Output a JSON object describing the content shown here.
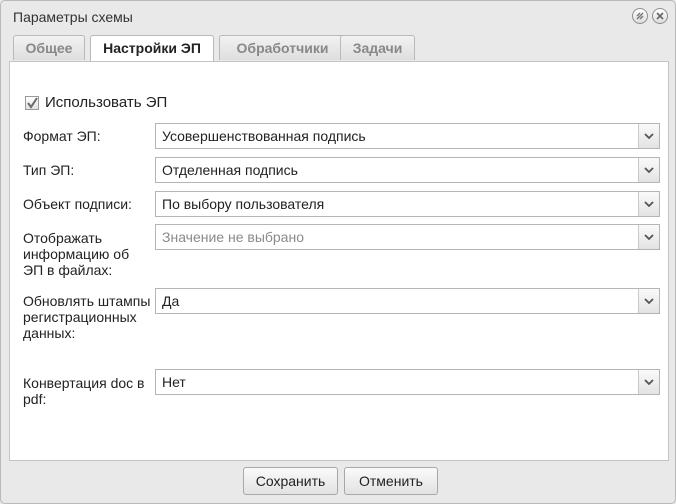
{
  "window": {
    "title": "Параметры схемы"
  },
  "tabs": [
    {
      "label": "Общее"
    },
    {
      "label": "Настройки ЭП"
    },
    {
      "label": "Обработчики"
    },
    {
      "label": "Задачи"
    }
  ],
  "form": {
    "use_ep": {
      "label": "Использовать ЭП",
      "checked": true
    },
    "format": {
      "label": "Формат ЭП:",
      "value": "Усовершенствованная подпись"
    },
    "type": {
      "label": "Тип ЭП:",
      "value": "Отделенная подпись"
    },
    "object": {
      "label": "Объект подписи:",
      "value": "По выбору пользователя"
    },
    "display": {
      "label": "Отображать информацию об ЭП в файлах:",
      "placeholder": "Значение не выбрано"
    },
    "update": {
      "label": "Обновлять штампы регистрационных данных:",
      "value": "Да"
    },
    "convert": {
      "label": "Конвертация doc в pdf:",
      "value": "Нет"
    }
  },
  "buttons": {
    "save": "Сохранить",
    "cancel": "Отменить"
  },
  "icons": {
    "collapse": "collapse-icon",
    "close": "close-icon",
    "checkbox": "checkmark-icon",
    "dropdown": "chevron-down-icon"
  }
}
